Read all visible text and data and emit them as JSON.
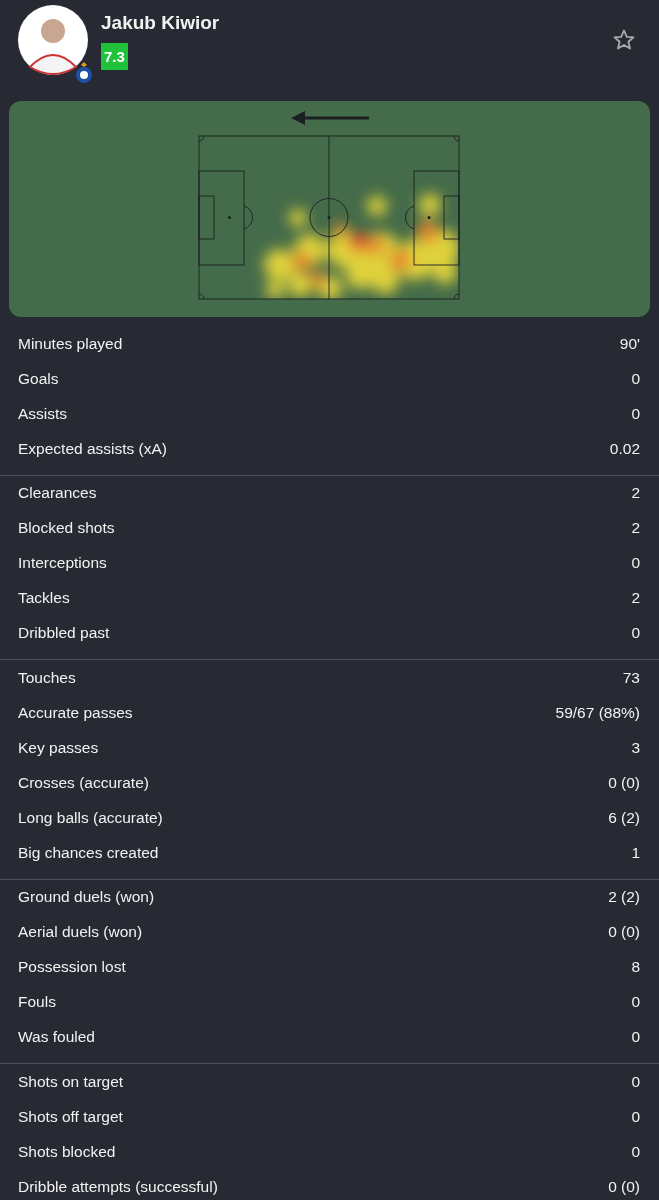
{
  "player": {
    "name": "Jakub Kiwior",
    "rating": "7.3",
    "favorite": false
  },
  "heatmap": {
    "kind": "heatmap"
  },
  "stat_groups": [
    {
      "rows": [
        {
          "label": "Minutes played",
          "value": "90'"
        },
        {
          "label": "Goals",
          "value": "0"
        },
        {
          "label": "Assists",
          "value": "0"
        },
        {
          "label": "Expected assists (xA)",
          "value": "0.02"
        }
      ]
    },
    {
      "rows": [
        {
          "label": "Clearances",
          "value": "2"
        },
        {
          "label": "Blocked shots",
          "value": "2"
        },
        {
          "label": "Interceptions",
          "value": "0"
        },
        {
          "label": "Tackles",
          "value": "2"
        },
        {
          "label": "Dribbled past",
          "value": "0"
        }
      ]
    },
    {
      "rows": [
        {
          "label": "Touches",
          "value": "73"
        },
        {
          "label": "Accurate passes",
          "value": "59/67 (88%)"
        },
        {
          "label": "Key passes",
          "value": "3"
        },
        {
          "label": "Crosses (accurate)",
          "value": "0 (0)"
        },
        {
          "label": "Long balls (accurate)",
          "value": "6 (2)"
        },
        {
          "label": "Big chances created",
          "value": "1"
        }
      ]
    },
    {
      "rows": [
        {
          "label": "Ground duels (won)",
          "value": "2 (2)"
        },
        {
          "label": "Aerial duels (won)",
          "value": "0 (0)"
        },
        {
          "label": "Possession lost",
          "value": "8"
        },
        {
          "label": "Fouls",
          "value": "0"
        },
        {
          "label": "Was fouled",
          "value": "0"
        }
      ]
    },
    {
      "rows": [
        {
          "label": "Shots on target",
          "value": "0"
        },
        {
          "label": "Shots off target",
          "value": "0"
        },
        {
          "label": "Shots blocked",
          "value": "0"
        },
        {
          "label": "Dribble attempts (successful)",
          "value": "0 (0)"
        }
      ]
    }
  ]
}
